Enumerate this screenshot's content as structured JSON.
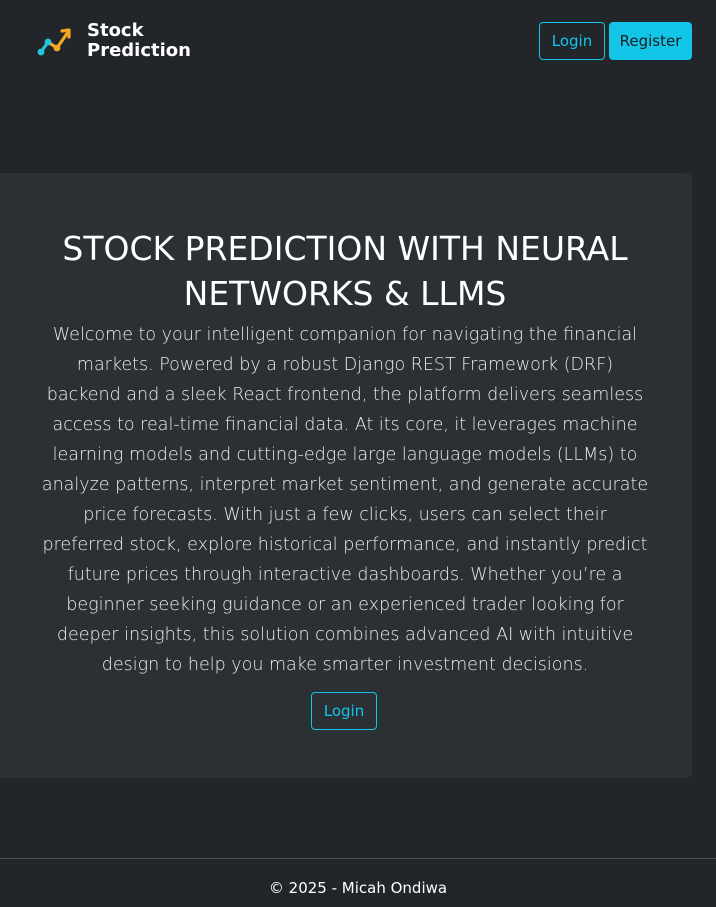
{
  "brand": {
    "name_line1": "Stock",
    "name_line2": "Prediction",
    "logo_colors": {
      "teal": "#26c6da",
      "orange": "#f5a623"
    }
  },
  "nav": {
    "login_label": "Login",
    "register_label": "Register"
  },
  "hero": {
    "title": "STOCK PREDICTION WITH NEURAL NETWORKS & LLMS",
    "description": "Welcome to your intelligent companion for navigating the financial markets. Powered by a robust Django REST Framework (DRF) backend and a sleek React frontend, the platform delivers seamless access to real-time financial data. At its core, it leverages machine learning models and cutting-edge large language models (LLMs) to analyze patterns, interpret market sentiment, and generate accurate price forecasts. With just a few clicks, users can select their preferred stock, explore historical performance, and instantly predict future prices through interactive dashboards. Whether you’re a beginner seeking guidance or an experienced trader looking for deeper insights, this solution combines advanced AI with intuitive design to help you make smarter investment decisions.",
    "login_label": "Login"
  },
  "footer": {
    "text": "© 2025 - Micah Ondiwa"
  },
  "colors": {
    "background": "#22262b",
    "card": "#2b3035",
    "accent": "#13c5e6"
  }
}
